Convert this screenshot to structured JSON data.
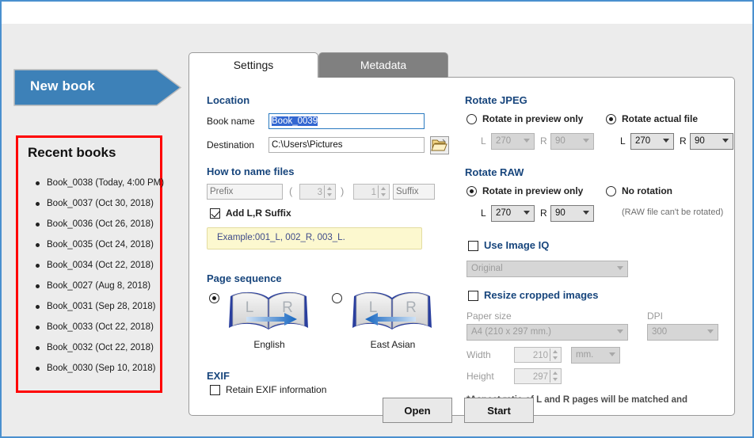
{
  "sidebar": {
    "new_book_label": "New book",
    "recent_title": "Recent books",
    "recent_books": [
      "Book_0038 (Today, 4:00 PM)",
      "Book_0037 (Oct 30, 2018)",
      "Book_0036 (Oct 26, 2018)",
      "Book_0035 (Oct 24, 2018)",
      "Book_0034 (Oct 22, 2018)",
      "Book_0027 (Aug 8, 2018)",
      "Book_0031 (Sep 28, 2018)",
      "Book_0033 (Oct 22, 2018)",
      "Book_0032 (Oct 22, 2018)",
      "Book_0030 (Sep 10, 2018)"
    ]
  },
  "tabs": {
    "settings": "Settings",
    "metadata": "Metadata",
    "active": "Settings"
  },
  "location": {
    "title": "Location",
    "book_name_label": "Book name",
    "book_name_value": "Book_0039",
    "destination_label": "Destination",
    "destination_value": "C:\\Users\\Pictures",
    "browse_icon": "open-folder-icon"
  },
  "naming": {
    "title": "How to name files",
    "prefix_placeholder": "Prefix",
    "suffix_placeholder": "Suffix",
    "open_paren": "(",
    "close_paren": ")",
    "digits_value": "3",
    "start_value": "1",
    "add_lr_label": "Add L,R Suffix",
    "add_lr_checked": true,
    "example_text": "Example:001_L, 002_R, 003_L."
  },
  "page_sequence": {
    "title": "Page sequence",
    "options": [
      {
        "caption": "English",
        "selected": true,
        "arrow": "right",
        "left_letter": "L",
        "right_letter": "R"
      },
      {
        "caption": "East Asian",
        "selected": false,
        "arrow": "left",
        "left_letter": "L",
        "right_letter": "R"
      }
    ]
  },
  "exif": {
    "title": "EXIF",
    "retain_label": "Retain EXIF information",
    "retain_checked": false
  },
  "rotate_jpeg": {
    "title": "Rotate JPEG",
    "preview_only_label": "Rotate in preview only",
    "preview_only_selected": false,
    "actual_file_label": "Rotate actual file",
    "actual_file_selected": true,
    "left_label": "L",
    "right_label": "R",
    "preview_l_value": "270",
    "preview_r_value": "90",
    "actual_l_value": "270",
    "actual_r_value": "90"
  },
  "rotate_raw": {
    "title": "Rotate RAW",
    "preview_only_label": "Rotate in preview only",
    "preview_only_selected": true,
    "no_rotation_label": "No rotation",
    "no_rotation_selected": false,
    "left_label": "L",
    "right_label": "R",
    "l_value": "270",
    "r_value": "90",
    "note": "(RAW file can't be rotated)"
  },
  "image_iq": {
    "label": "Use Image IQ",
    "checked": false,
    "preset_value": "Original"
  },
  "resize": {
    "label": "Resize cropped images",
    "checked": false,
    "paper_size_label": "Paper size",
    "paper_size_value": "A4 (210 x 297 mm.)",
    "dpi_label": "DPI",
    "dpi_value": "300",
    "width_label": "Width",
    "width_value": "210",
    "unit_value": "mm.",
    "height_label": "Height",
    "height_value": "297",
    "aspect_note": "*Aspect ratio of L and R pages will be matched and controlled."
  },
  "footer": {
    "open_label": "Open",
    "start_label": "Start"
  },
  "colors": {
    "accent_blue": "#3d81b8",
    "section_heading": "#17457c",
    "highlight_red": "#ff0000",
    "example_bg": "#fcf8cf"
  }
}
